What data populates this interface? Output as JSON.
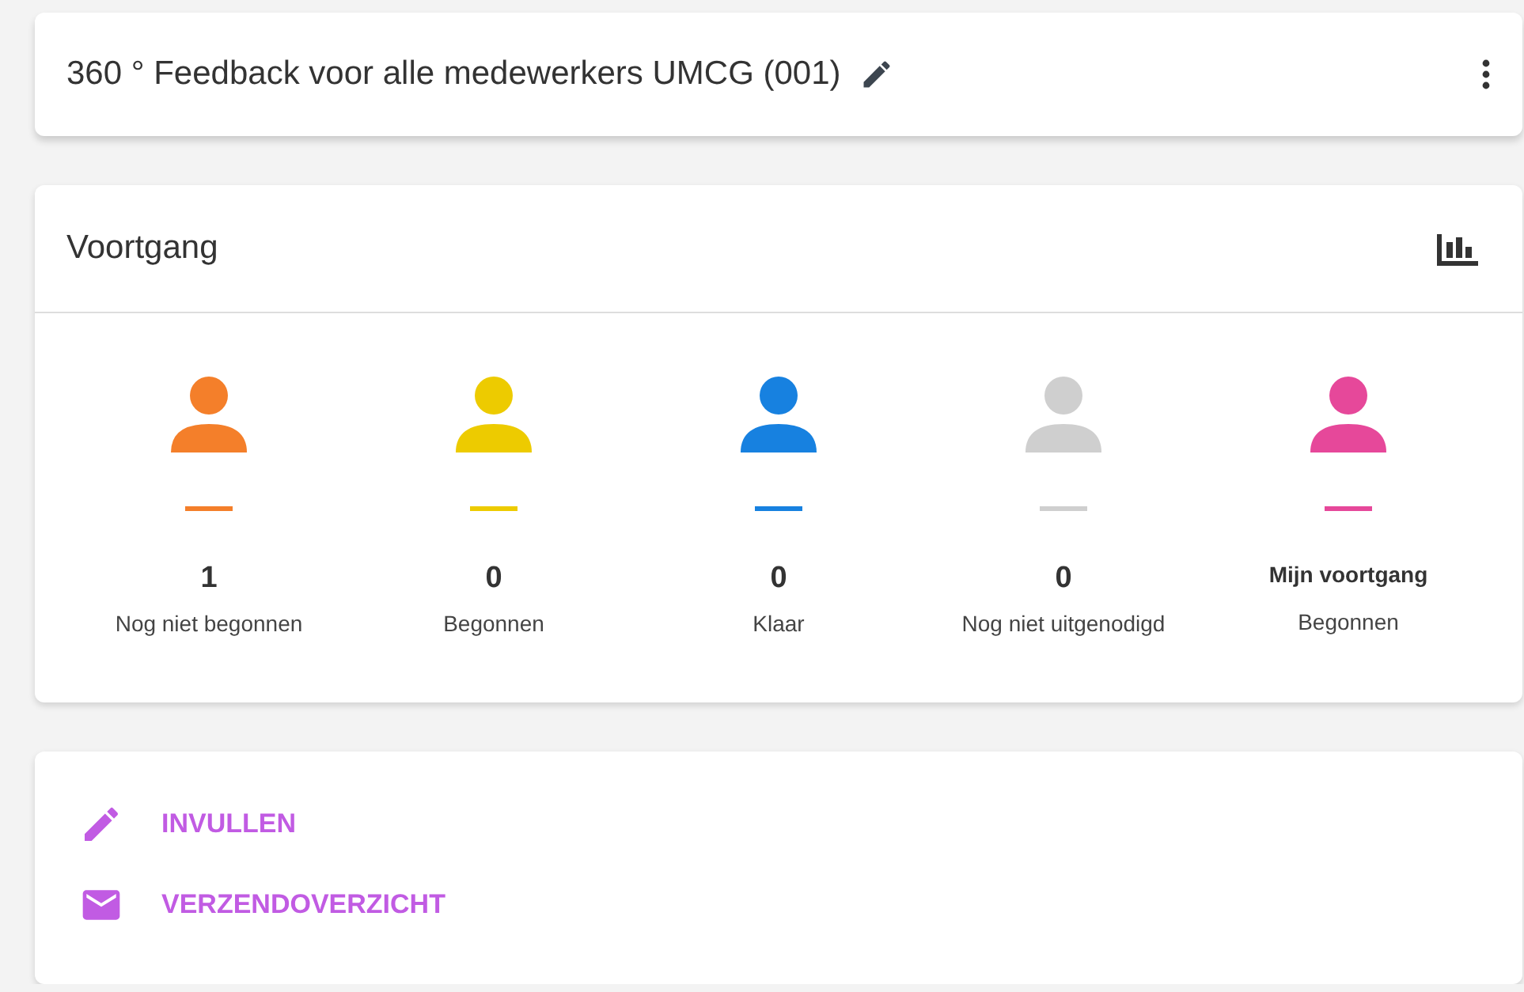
{
  "header": {
    "title": "360 ° Feedback voor alle medewerkers UMCG (001)"
  },
  "progress": {
    "title": "Voortgang",
    "stats": [
      {
        "kind": "count",
        "value": "1",
        "label": "Nog niet begonnen",
        "color": "#f47f2a"
      },
      {
        "kind": "count",
        "value": "0",
        "label": "Begonnen",
        "color": "#edcb00"
      },
      {
        "kind": "count",
        "value": "0",
        "label": "Klaar",
        "color": "#1781e0"
      },
      {
        "kind": "count",
        "value": "0",
        "label": "Nog niet uitgenodigd",
        "color": "#cfcfcf"
      },
      {
        "kind": "personal",
        "value": "Mijn voortgang",
        "label": "Begonnen",
        "color": "#e6489a"
      }
    ]
  },
  "actions": [
    {
      "kind": "edit",
      "label": "INVULLEN"
    },
    {
      "kind": "mail",
      "label": "VERZENDOVERZICHT"
    }
  ]
}
